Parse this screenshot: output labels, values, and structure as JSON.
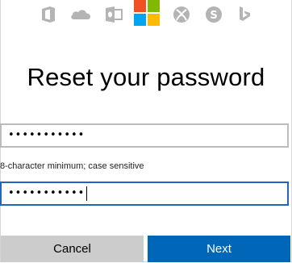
{
  "header": {
    "icons": [
      "office-icon",
      "onedrive-icon",
      "outlook-icon",
      "microsoft-logo-icon",
      "xbox-icon",
      "skype-icon",
      "bing-icon"
    ],
    "colors": {
      "gray": "#b4b4b4",
      "ms_red": "#f25022",
      "ms_green": "#7fba00",
      "ms_blue": "#00a4ef",
      "ms_yellow": "#ffb900"
    }
  },
  "form": {
    "title": "Reset your password",
    "new_password_value": "•••••••••••",
    "hint": "8-character minimum; case sensitive",
    "confirm_password_value": "•••••••••••"
  },
  "actions": {
    "cancel_label": "Cancel",
    "next_label": "Next"
  },
  "colors": {
    "accent": "#0067b8",
    "focus_border": "#2166b8",
    "cancel_bg": "#cccccc"
  }
}
